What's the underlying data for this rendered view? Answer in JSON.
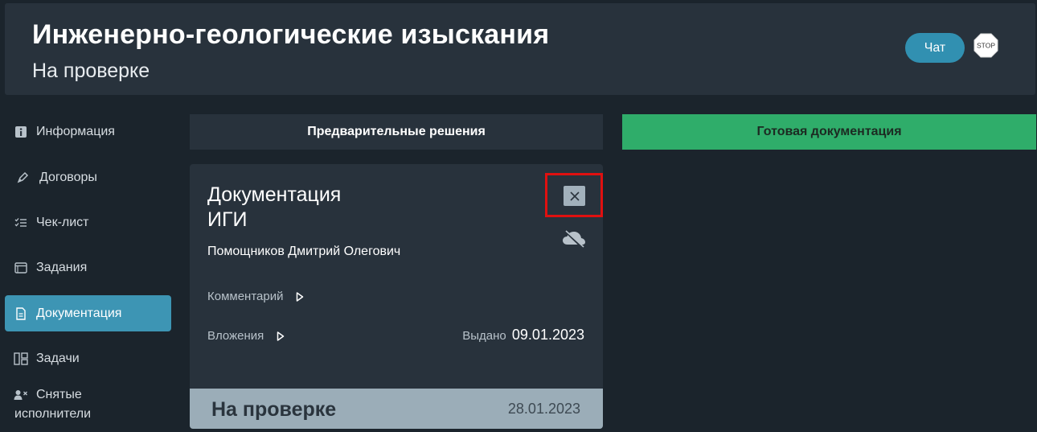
{
  "header": {
    "title": "Инженерно-геологические изыскания",
    "subtitle": "На проверке",
    "chat_label": "Чат",
    "stop_label": "STOP"
  },
  "sidebar": {
    "items": [
      {
        "label": "Информация",
        "icon": "info-icon"
      },
      {
        "label": "Договоры",
        "icon": "pen-icon"
      },
      {
        "label": "Чек-лист",
        "icon": "checklist-icon"
      },
      {
        "label": "Задания",
        "icon": "tasks-window-icon"
      },
      {
        "label": "Документация",
        "icon": "document-icon",
        "active": true
      },
      {
        "label": "Задачи",
        "icon": "board-icon"
      },
      {
        "label": "Снятые исполнители",
        "icon": "user-remove-icon",
        "line1": "Снятые",
        "line2": "исполнители"
      }
    ]
  },
  "tabs": {
    "prelim": "Предварительные решения",
    "ready": "Готовая документация"
  },
  "card": {
    "title_line1": "Документация",
    "title_line2": "ИГИ",
    "person": "Помощников Дмитрий Олегович",
    "comment_label": "Комментарий",
    "attachments_label": "Вложения",
    "issued_label": "Выдано",
    "issued_date": "09.01.2023",
    "status": "На проверке",
    "status_date": "28.01.2023"
  },
  "colors": {
    "background": "#1b242c",
    "panel": "#28323c",
    "accent": "#3d95b4",
    "ready_tab": "#2fad6a",
    "highlight": "#e01010",
    "status_bar": "#9badb8"
  }
}
